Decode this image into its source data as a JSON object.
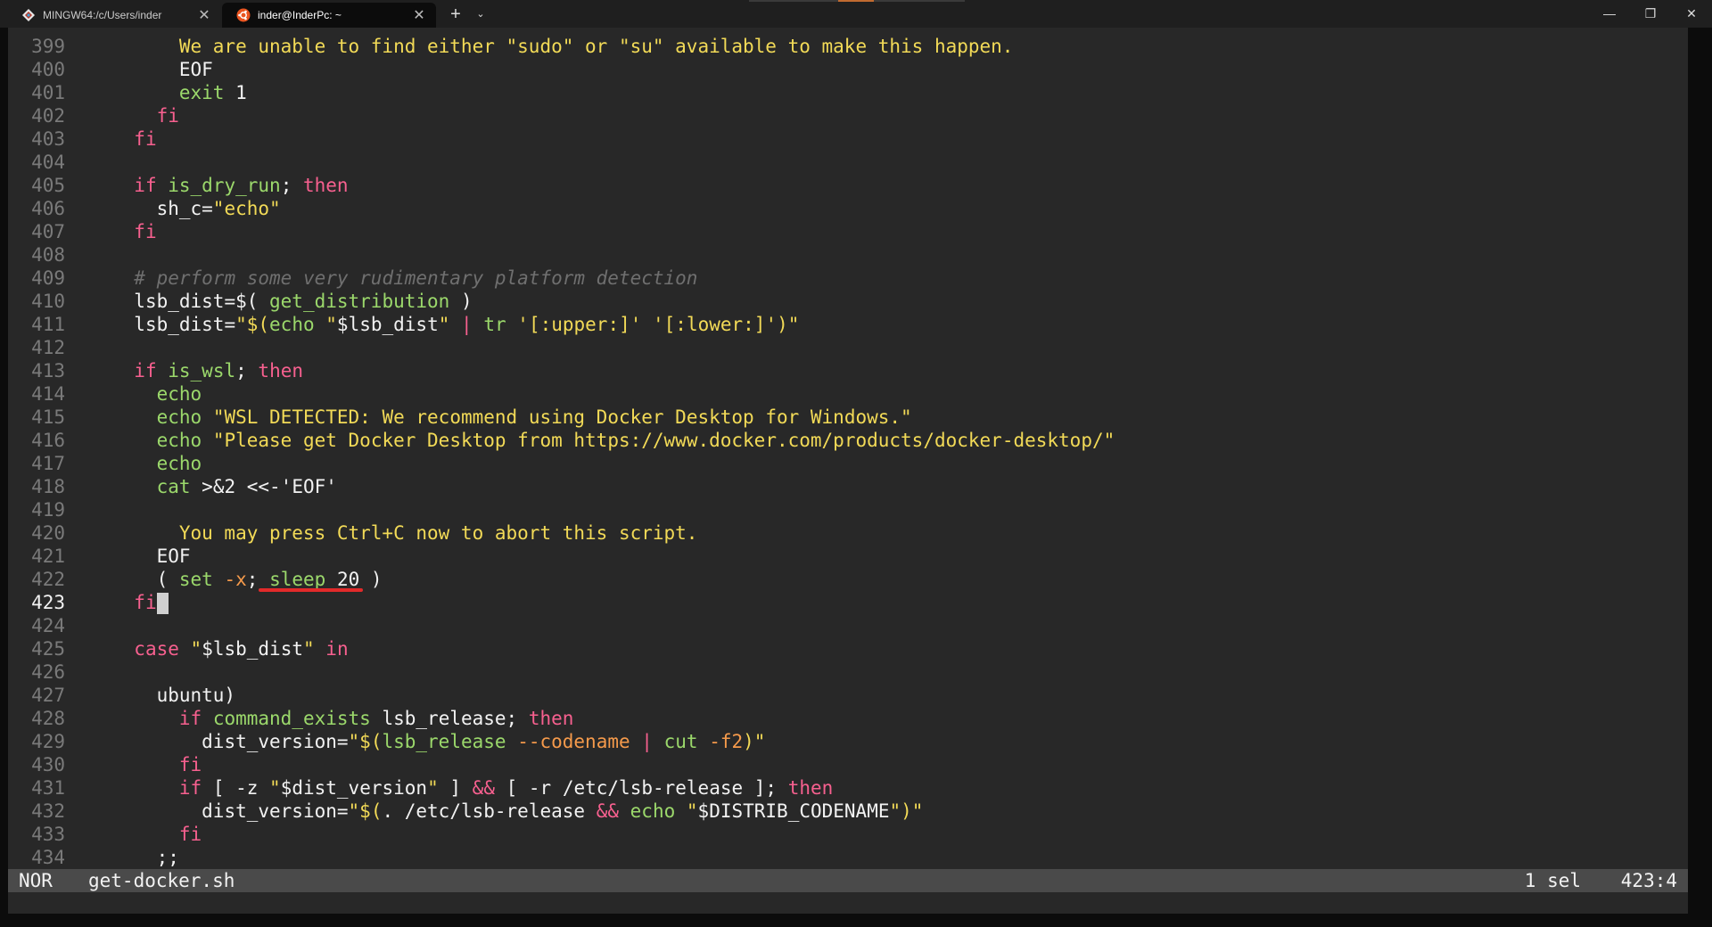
{
  "tabs": [
    {
      "title": "MINGW64:/c/Users/inder",
      "icon": "git-bash-icon",
      "active": false
    },
    {
      "title": "inder@InderPc: ~",
      "icon": "ubuntu-icon",
      "active": true
    }
  ],
  "tab_bar": {
    "new_tab": "+",
    "dropdown": "⌄",
    "close": "✕"
  },
  "window_controls": {
    "minimize": "—",
    "maximize": "❐",
    "close": "✕"
  },
  "editor": {
    "current_line": 423,
    "lines": [
      {
        "n": "399",
        "html": "      <span class=\"s\">We are unable to find either \"sudo\" or \"su\" available to make this happen.</span>"
      },
      {
        "n": "400",
        "html": "      <span class=\"p\">EOF</span>"
      },
      {
        "n": "401",
        "html": "      <span class=\"f\">exit</span> <span class=\"p\">1</span>"
      },
      {
        "n": "402",
        "html": "    <span class=\"k\">fi</span>"
      },
      {
        "n": "403",
        "html": "  <span class=\"k\">fi</span>"
      },
      {
        "n": "404",
        "html": ""
      },
      {
        "n": "405",
        "html": "  <span class=\"k\">if</span> <span class=\"f\">is_dry_run</span><span class=\"p\">;</span> <span class=\"k\">then</span>"
      },
      {
        "n": "406",
        "html": "    <span class=\"p\">sh_c=</span><span class=\"s\">\"echo\"</span>"
      },
      {
        "n": "407",
        "html": "  <span class=\"k\">fi</span>"
      },
      {
        "n": "408",
        "html": ""
      },
      {
        "n": "409",
        "html": "  <span class=\"c\"># perform some very rudimentary platform detection</span>"
      },
      {
        "n": "410",
        "html": "  <span class=\"p\">lsb_dist=$( </span><span class=\"f\">get_distribution</span><span class=\"p\"> )</span>"
      },
      {
        "n": "411",
        "html": "  <span class=\"p\">lsb_dist=</span><span class=\"s\">\"$(</span><span class=\"f\">echo</span> <span class=\"s\">\"</span><span class=\"p\">$lsb_dist</span><span class=\"s\">\"</span> <span class=\"k\">|</span> <span class=\"f\">tr</span> <span class=\"s\">'[:upper:]' '[:lower:]'</span><span class=\"s\">)\"</span>"
      },
      {
        "n": "412",
        "html": ""
      },
      {
        "n": "413",
        "html": "  <span class=\"k\">if</span> <span class=\"f\">is_wsl</span><span class=\"p\">;</span> <span class=\"k\">then</span>"
      },
      {
        "n": "414",
        "html": "    <span class=\"f\">echo</span>"
      },
      {
        "n": "415",
        "html": "    <span class=\"f\">echo</span> <span class=\"s\">\"WSL DETECTED: We recommend using Docker Desktop for Windows.\"</span>"
      },
      {
        "n": "416",
        "html": "    <span class=\"f\">echo</span> <span class=\"s\">\"Please get Docker Desktop from https://www.docker.com/products/docker-desktop/\"</span>"
      },
      {
        "n": "417",
        "html": "    <span class=\"f\">echo</span>"
      },
      {
        "n": "418",
        "html": "    <span class=\"f\">cat</span> <span class=\"p\">&gt;&amp;2 &lt;&lt;-'EOF'</span>"
      },
      {
        "n": "419",
        "html": ""
      },
      {
        "n": "420",
        "html": "      <span class=\"s\">You may press Ctrl+C now to abort this script.</span>"
      },
      {
        "n": "421",
        "html": "    <span class=\"p\">EOF</span>"
      },
      {
        "n": "422",
        "html": "    <span class=\"p\">( </span><span class=\"f\">set</span> <span class=\"o\">-x</span><span class=\"p\">; </span><span class=\"f\">sleep</span> <span class=\"p\">20 )</span>"
      },
      {
        "n": "423",
        "html": "  <span class=\"k\">fi</span><span class=\"cursor\"> </span>"
      },
      {
        "n": "424",
        "html": ""
      },
      {
        "n": "425",
        "html": "  <span class=\"k\">case</span> <span class=\"s\">\"</span><span class=\"p\">$lsb_dist</span><span class=\"s\">\"</span> <span class=\"k\">in</span>"
      },
      {
        "n": "426",
        "html": ""
      },
      {
        "n": "427",
        "html": "    <span class=\"p\">ubuntu)</span>"
      },
      {
        "n": "428",
        "html": "      <span class=\"k\">if</span> <span class=\"f\">command_exists</span> <span class=\"p\">lsb_release;</span> <span class=\"k\">then</span>"
      },
      {
        "n": "429",
        "html": "        <span class=\"p\">dist_version=</span><span class=\"s\">\"$(</span><span class=\"f\">lsb_release</span> <span class=\"o\">--codename</span> <span class=\"k\">|</span> <span class=\"f\">cut</span> <span class=\"o\">-f2</span><span class=\"s\">)\"</span>"
      },
      {
        "n": "430",
        "html": "      <span class=\"k\">fi</span>"
      },
      {
        "n": "431",
        "html": "      <span class=\"k\">if</span> <span class=\"p\">[ -z </span><span class=\"s\">\"</span><span class=\"p\">$dist_version</span><span class=\"s\">\"</span><span class=\"p\"> ]</span> <span class=\"k\">&amp;&amp;</span> <span class=\"p\">[ -r /etc/lsb-release ];</span> <span class=\"k\">then</span>"
      },
      {
        "n": "432",
        "html": "        <span class=\"p\">dist_version=</span><span class=\"s\">\"$(</span><span class=\"p\">. /etc/lsb-release</span> <span class=\"k\">&amp;&amp;</span> <span class=\"f\">echo</span> <span class=\"s\">\"</span><span class=\"p\">$DISTRIB_CODENAME</span><span class=\"s\">\")\"</span>"
      },
      {
        "n": "433",
        "html": "      <span class=\"k\">fi</span>"
      },
      {
        "n": "434",
        "html": "    <span class=\"p\">;;</span>"
      }
    ]
  },
  "status": {
    "mode": "NOR",
    "filename": "get-docker.sh",
    "selection": "1 sel",
    "position": "423:4"
  },
  "colors": {
    "keyword": "#f7608f",
    "function": "#9bd86b",
    "string": "#f2da57",
    "comment": "#6f6f6f",
    "option": "#f59a4b",
    "background": "#282828",
    "annotation": "#e22a2a"
  }
}
